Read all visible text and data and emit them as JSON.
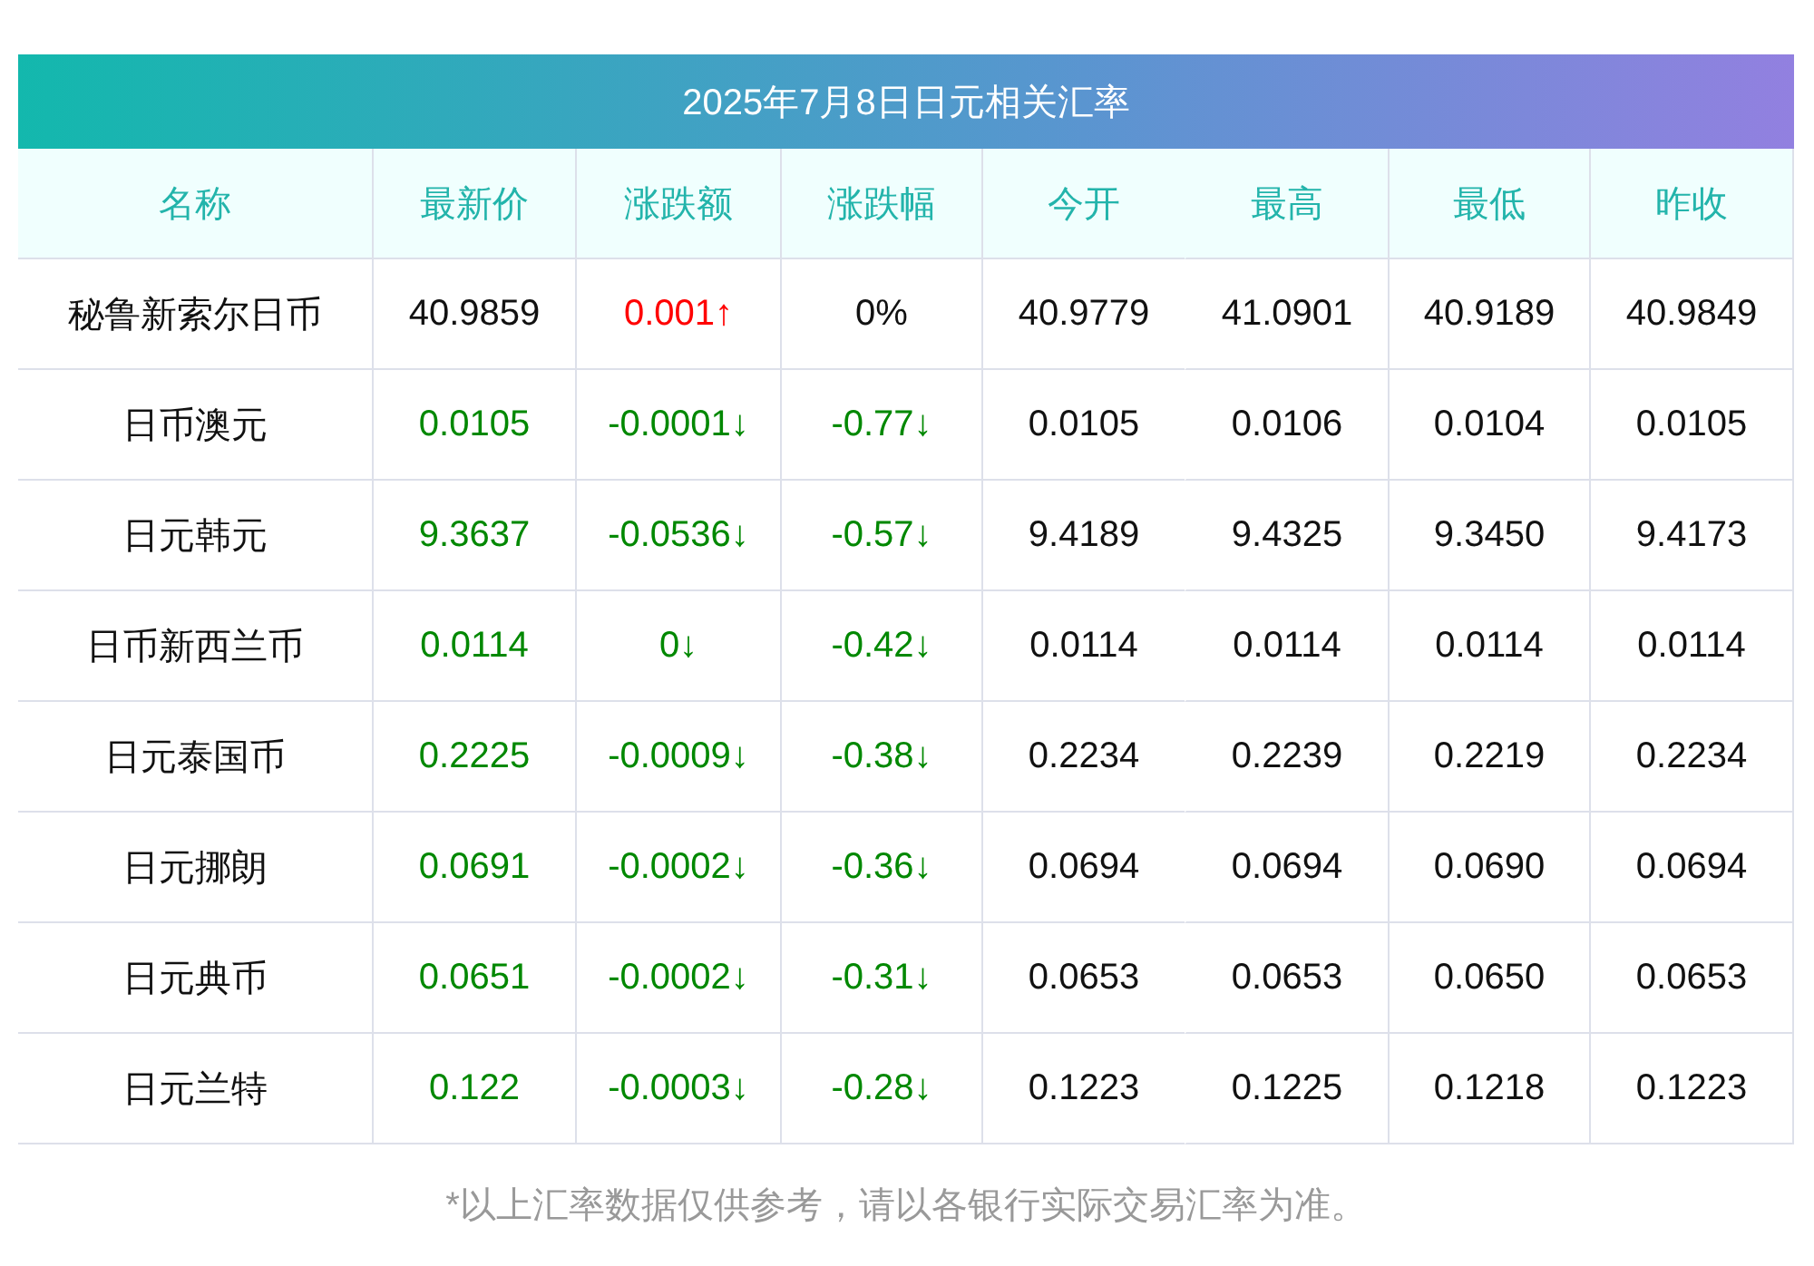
{
  "title": "2025年7月8日日元相关汇率",
  "columns": [
    "名称",
    "最新价",
    "涨跌额",
    "涨跌幅",
    "今开",
    "最高",
    "最低",
    "昨收"
  ],
  "rows": [
    {
      "cells": [
        {
          "text": "秘鲁新索尔日币",
          "color": "#111111"
        },
        {
          "text": "40.9859",
          "color": "#111111"
        },
        {
          "text": "0.001↑",
          "color": "#ff0000"
        },
        {
          "text": "0%",
          "color": "#111111"
        },
        {
          "text": "40.9779",
          "color": "#111111"
        },
        {
          "text": "41.0901",
          "color": "#111111"
        },
        {
          "text": "40.9189",
          "color": "#111111"
        },
        {
          "text": "40.9849",
          "color": "#111111"
        }
      ]
    },
    {
      "cells": [
        {
          "text": "日币澳元",
          "color": "#111111"
        },
        {
          "text": "0.0105",
          "color": "#008800"
        },
        {
          "text": "-0.0001↓",
          "color": "#008800"
        },
        {
          "text": "-0.77↓",
          "color": "#008800"
        },
        {
          "text": "0.0105",
          "color": "#111111"
        },
        {
          "text": "0.0106",
          "color": "#111111"
        },
        {
          "text": "0.0104",
          "color": "#111111"
        },
        {
          "text": "0.0105",
          "color": "#111111"
        }
      ]
    },
    {
      "cells": [
        {
          "text": "日元韩元",
          "color": "#111111"
        },
        {
          "text": "9.3637",
          "color": "#008800"
        },
        {
          "text": "-0.0536↓",
          "color": "#008800"
        },
        {
          "text": "-0.57↓",
          "color": "#008800"
        },
        {
          "text": "9.4189",
          "color": "#111111"
        },
        {
          "text": "9.4325",
          "color": "#111111"
        },
        {
          "text": "9.3450",
          "color": "#111111"
        },
        {
          "text": "9.4173",
          "color": "#111111"
        }
      ]
    },
    {
      "cells": [
        {
          "text": "日币新西兰币",
          "color": "#111111"
        },
        {
          "text": "0.0114",
          "color": "#008800"
        },
        {
          "text": "0↓",
          "color": "#008800"
        },
        {
          "text": "-0.42↓",
          "color": "#008800"
        },
        {
          "text": "0.0114",
          "color": "#111111"
        },
        {
          "text": "0.0114",
          "color": "#111111"
        },
        {
          "text": "0.0114",
          "color": "#111111"
        },
        {
          "text": "0.0114",
          "color": "#111111"
        }
      ]
    },
    {
      "cells": [
        {
          "text": "日元泰国币",
          "color": "#111111"
        },
        {
          "text": "0.2225",
          "color": "#008800"
        },
        {
          "text": "-0.0009↓",
          "color": "#008800"
        },
        {
          "text": "-0.38↓",
          "color": "#008800"
        },
        {
          "text": "0.2234",
          "color": "#111111"
        },
        {
          "text": "0.2239",
          "color": "#111111"
        },
        {
          "text": "0.2219",
          "color": "#111111"
        },
        {
          "text": "0.2234",
          "color": "#111111"
        }
      ]
    },
    {
      "cells": [
        {
          "text": "日元挪朗",
          "color": "#111111"
        },
        {
          "text": "0.0691",
          "color": "#008800"
        },
        {
          "text": "-0.0002↓",
          "color": "#008800"
        },
        {
          "text": "-0.36↓",
          "color": "#008800"
        },
        {
          "text": "0.0694",
          "color": "#111111"
        },
        {
          "text": "0.0694",
          "color": "#111111"
        },
        {
          "text": "0.0690",
          "color": "#111111"
        },
        {
          "text": "0.0694",
          "color": "#111111"
        }
      ]
    },
    {
      "cells": [
        {
          "text": "日元典币",
          "color": "#111111"
        },
        {
          "text": "0.0651",
          "color": "#008800"
        },
        {
          "text": "-0.0002↓",
          "color": "#008800"
        },
        {
          "text": "-0.31↓",
          "color": "#008800"
        },
        {
          "text": "0.0653",
          "color": "#111111"
        },
        {
          "text": "0.0653",
          "color": "#111111"
        },
        {
          "text": "0.0650",
          "color": "#111111"
        },
        {
          "text": "0.0653",
          "color": "#111111"
        }
      ]
    },
    {
      "cells": [
        {
          "text": "日元兰特",
          "color": "#111111"
        },
        {
          "text": "0.122",
          "color": "#008800"
        },
        {
          "text": "-0.0003↓",
          "color": "#008800"
        },
        {
          "text": "-0.28↓",
          "color": "#008800"
        },
        {
          "text": "0.1223",
          "color": "#111111"
        },
        {
          "text": "0.1225",
          "color": "#111111"
        },
        {
          "text": "0.1218",
          "color": "#111111"
        },
        {
          "text": "0.1223",
          "color": "#111111"
        }
      ]
    }
  ],
  "footnote": "*以上汇率数据仅供参考，请以各银行实际交易汇率为准。"
}
